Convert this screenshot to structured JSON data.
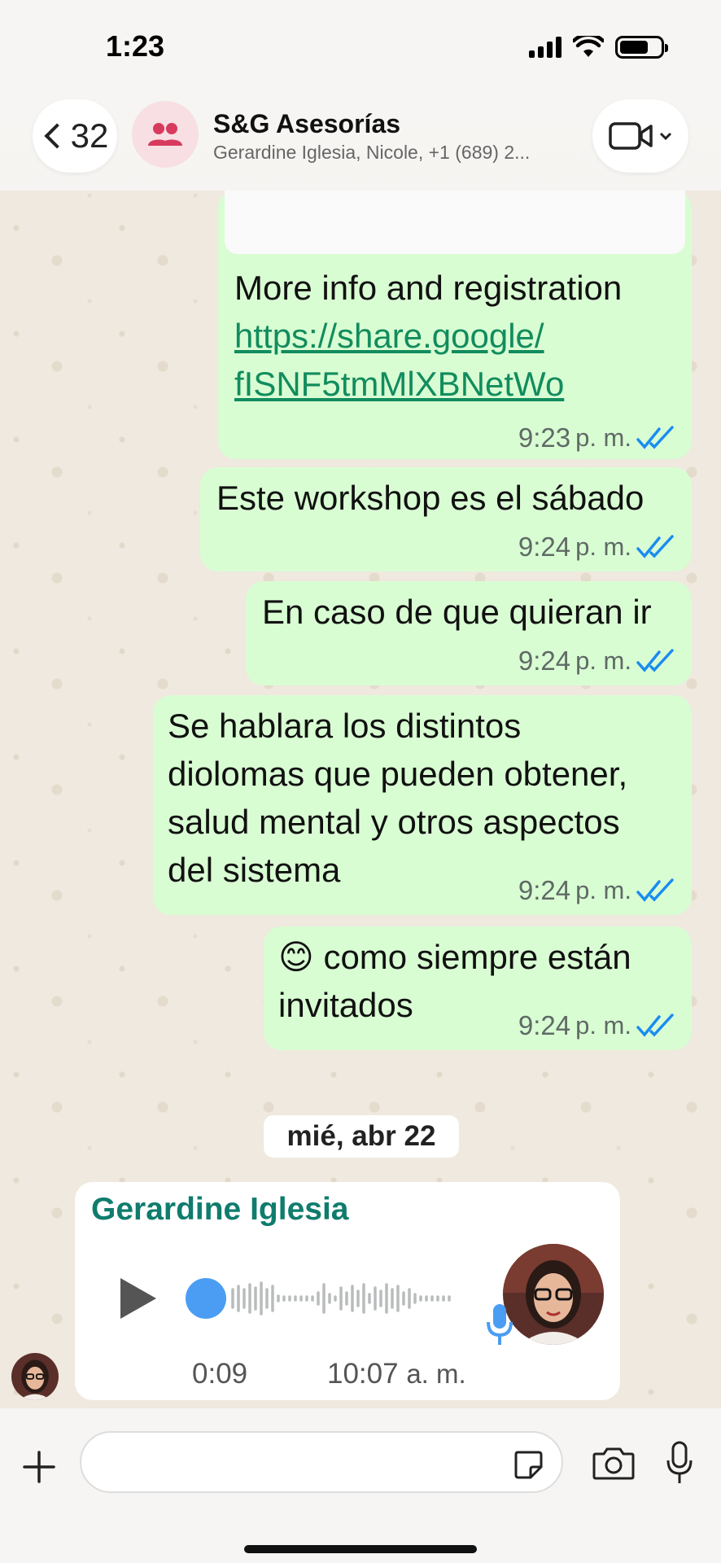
{
  "status_bar": {
    "time": "1:23"
  },
  "header": {
    "back_count": "32",
    "title": "S&G Asesorías",
    "subtitle": "Gerardine Iglesia, Nicole, +1 (689) 2..."
  },
  "messages": [
    {
      "lines": [
        "More info and registration"
      ],
      "link_lines": [
        "https://share.google/",
        "fISNF5tmMlXBNetWo"
      ],
      "time": "9:23",
      "ampm": "p. m."
    },
    {
      "lines": [
        "Este workshop es el sábado"
      ],
      "time": "9:24",
      "ampm": "p. m."
    },
    {
      "lines": [
        "En caso de que quieran ir"
      ],
      "time": "9:24",
      "ampm": "p. m."
    },
    {
      "lines": [
        "Se hablara los distintos",
        "diolomas que pueden obtener,",
        "salud mental y otros aspectos",
        "del sistema"
      ],
      "time": "9:24",
      "ampm": "p. m."
    },
    {
      "lines": [
        "😊 como siempre están",
        "invitados"
      ],
      "time": "9:24",
      "ampm": "p. m."
    }
  ],
  "date_separator": "mié, abr 22",
  "voice_message": {
    "sender": "Gerardine Iglesia",
    "duration": "0:09",
    "time": "10:07",
    "ampm": "a. m."
  },
  "colors": {
    "outgoing_bubble": "#d9fdd3",
    "sender_name": "#0f7c6d",
    "read_ticks": "#1a8cf0",
    "link": "#128c5e"
  }
}
